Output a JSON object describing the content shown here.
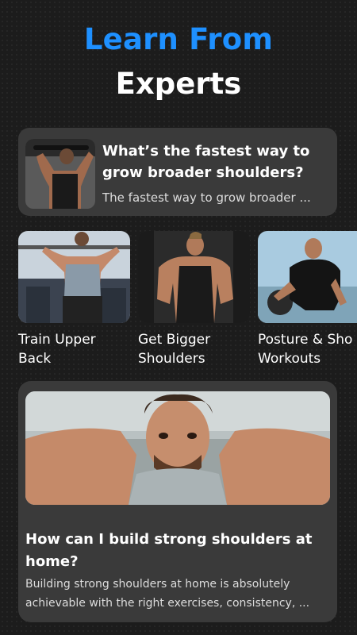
{
  "hero": {
    "line1": "Learn From",
    "line2": "Experts"
  },
  "featured": {
    "title": "What’s the fastest way to grow broader shoulders?",
    "desc": "The fastest way to grow broader ..."
  },
  "tiles": [
    {
      "label_line1": "Train Upper",
      "label_line2": "Back"
    },
    {
      "label_line1": "Get Bigger",
      "label_line2": "Shoulders"
    },
    {
      "label_line1": "Posture & Sho",
      "label_line2": "Workouts"
    }
  ],
  "article": {
    "title": "How can I build strong shoulders at home?",
    "desc": "Building strong shoulders at home is absolutely achievable with the right exercises, consistency, ..."
  },
  "colors": {
    "accent": "#1e90ff",
    "card": "#3a3a3a",
    "background": "#1c1c1c"
  }
}
